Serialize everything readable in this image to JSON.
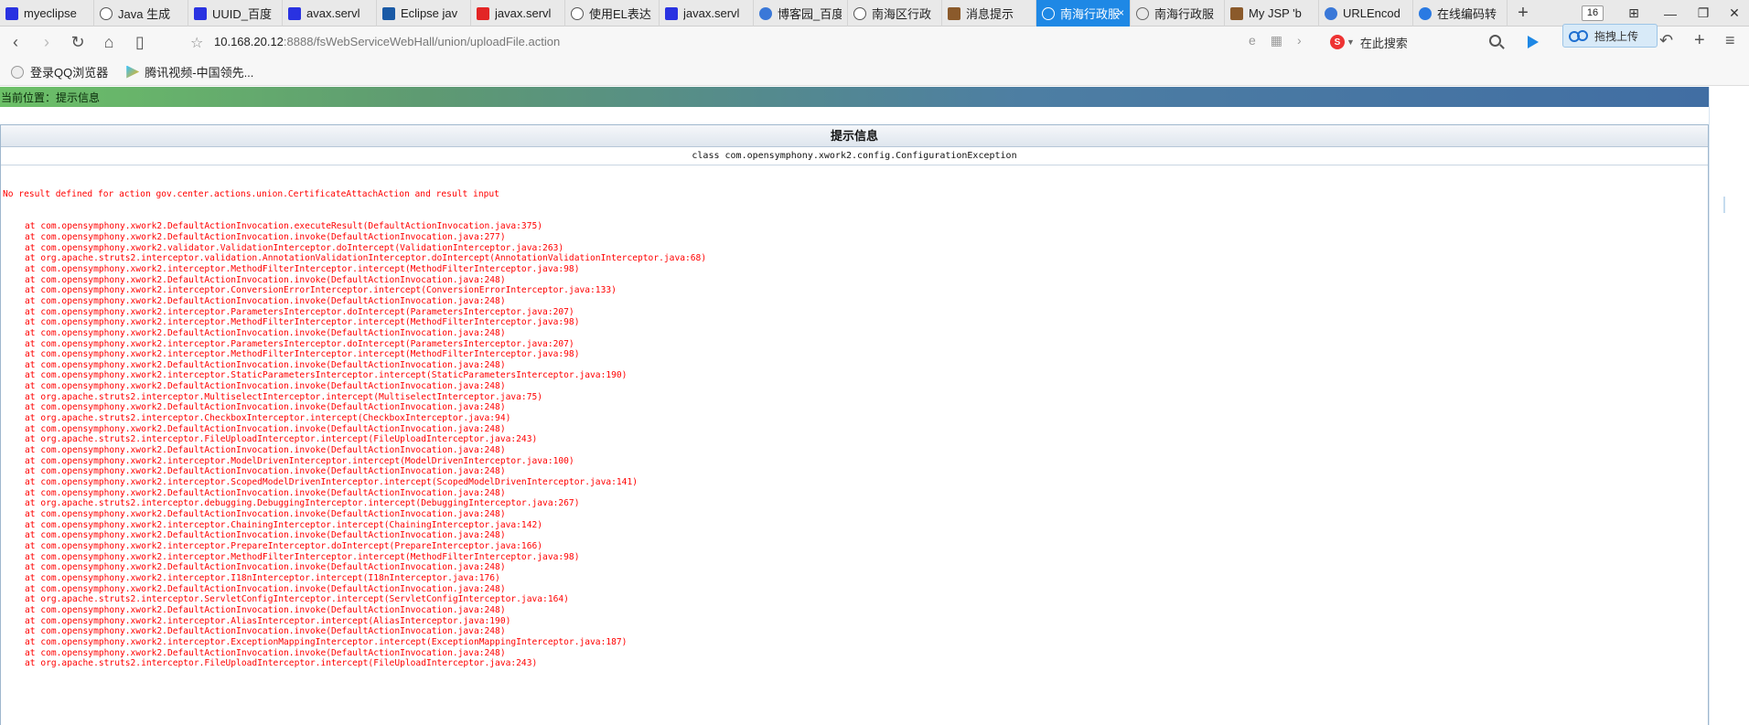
{
  "tabs": [
    {
      "label": "myeclipse",
      "icon": "baidu-paw-icon",
      "color": "#2932e1"
    },
    {
      "label": "Java 生成",
      "icon": "csdn-icon",
      "color": "#ffffff"
    },
    {
      "label": "UUID_百度",
      "icon": "baidu-paw-icon",
      "color": "#2932e1"
    },
    {
      "label": "avax.servl",
      "icon": "baidu-paw-icon",
      "color": "#2932e1"
    },
    {
      "label": "Eclipse jav",
      "icon": "c-logo-icon",
      "color": "#1a5aa6"
    },
    {
      "label": "javax.servl",
      "icon": "red-logo-icon",
      "color": "#e32525"
    },
    {
      "label": "使用EL表达",
      "icon": "csdn-icon",
      "color": "#ffffff"
    },
    {
      "label": "javax.servl",
      "icon": "baidu-paw-icon",
      "color": "#2932e1"
    },
    {
      "label": "博客园_百度",
      "icon": "paw-icon",
      "color": "#3a78d8"
    },
    {
      "label": "南海区行政",
      "icon": "csdn-icon",
      "color": "#ffffff"
    },
    {
      "label": "消息提示",
      "icon": "page-icon",
      "color": "#8b5a2b"
    },
    {
      "label": "南海行政服",
      "icon": "globe-icon",
      "color": "#ffffff",
      "active": true
    },
    {
      "label": "南海行政服",
      "icon": "globe-icon",
      "color": "#666666"
    },
    {
      "label": "My JSP 'b",
      "icon": "page-icon",
      "color": "#8b5a2b"
    },
    {
      "label": "URLEncod",
      "icon": "paw-icon",
      "color": "#3a78d8"
    },
    {
      "label": "在线编码转",
      "icon": "chrome-icon",
      "color": "#2a7ae2"
    }
  ],
  "tab_close": "×",
  "new_tab": "+",
  "tab_counter": "16",
  "window_controls": [
    "⊞",
    "—",
    "❐",
    "✕"
  ],
  "upload_tip": "拖拽上传",
  "address": {
    "host": "10.168.20.12",
    "path": ":8888/fsWebServiceWebHall/union/uploadFile.action",
    "search_placeholder": "在此搜索",
    "search_engine": "S"
  },
  "bookmarks": [
    {
      "label": "登录QQ浏览器",
      "icon": "user-icon"
    },
    {
      "label": "腾讯视频-中国领先...",
      "icon": "tencent-video-icon"
    }
  ],
  "location": "当前位置：提示信息",
  "panel": {
    "title": "提示信息",
    "exception_class": "class com.opensymphony.xwork2.config.ConfigurationException"
  },
  "trace": {
    "message": "No result defined for action gov.center.actions.union.CertificateAttachAction and result input",
    "frames": [
      "at com.opensymphony.xwork2.DefaultActionInvocation.executeResult(DefaultActionInvocation.java:375)",
      "at com.opensymphony.xwork2.DefaultActionInvocation.invoke(DefaultActionInvocation.java:277)",
      "at com.opensymphony.xwork2.validator.ValidationInterceptor.doIntercept(ValidationInterceptor.java:263)",
      "at org.apache.struts2.interceptor.validation.AnnotationValidationInterceptor.doIntercept(AnnotationValidationInterceptor.java:68)",
      "at com.opensymphony.xwork2.interceptor.MethodFilterInterceptor.intercept(MethodFilterInterceptor.java:98)",
      "at com.opensymphony.xwork2.DefaultActionInvocation.invoke(DefaultActionInvocation.java:248)",
      "at com.opensymphony.xwork2.interceptor.ConversionErrorInterceptor.intercept(ConversionErrorInterceptor.java:133)",
      "at com.opensymphony.xwork2.DefaultActionInvocation.invoke(DefaultActionInvocation.java:248)",
      "at com.opensymphony.xwork2.interceptor.ParametersInterceptor.doIntercept(ParametersInterceptor.java:207)",
      "at com.opensymphony.xwork2.interceptor.MethodFilterInterceptor.intercept(MethodFilterInterceptor.java:98)",
      "at com.opensymphony.xwork2.DefaultActionInvocation.invoke(DefaultActionInvocation.java:248)",
      "at com.opensymphony.xwork2.interceptor.ParametersInterceptor.doIntercept(ParametersInterceptor.java:207)",
      "at com.opensymphony.xwork2.interceptor.MethodFilterInterceptor.intercept(MethodFilterInterceptor.java:98)",
      "at com.opensymphony.xwork2.DefaultActionInvocation.invoke(DefaultActionInvocation.java:248)",
      "at com.opensymphony.xwork2.interceptor.StaticParametersInterceptor.intercept(StaticParametersInterceptor.java:190)",
      "at com.opensymphony.xwork2.DefaultActionInvocation.invoke(DefaultActionInvocation.java:248)",
      "at org.apache.struts2.interceptor.MultiselectInterceptor.intercept(MultiselectInterceptor.java:75)",
      "at com.opensymphony.xwork2.DefaultActionInvocation.invoke(DefaultActionInvocation.java:248)",
      "at org.apache.struts2.interceptor.CheckboxInterceptor.intercept(CheckboxInterceptor.java:94)",
      "at com.opensymphony.xwork2.DefaultActionInvocation.invoke(DefaultActionInvocation.java:248)",
      "at org.apache.struts2.interceptor.FileUploadInterceptor.intercept(FileUploadInterceptor.java:243)",
      "at com.opensymphony.xwork2.DefaultActionInvocation.invoke(DefaultActionInvocation.java:248)",
      "at com.opensymphony.xwork2.interceptor.ModelDrivenInterceptor.intercept(ModelDrivenInterceptor.java:100)",
      "at com.opensymphony.xwork2.DefaultActionInvocation.invoke(DefaultActionInvocation.java:248)",
      "at com.opensymphony.xwork2.interceptor.ScopedModelDrivenInterceptor.intercept(ScopedModelDrivenInterceptor.java:141)",
      "at com.opensymphony.xwork2.DefaultActionInvocation.invoke(DefaultActionInvocation.java:248)",
      "at org.apache.struts2.interceptor.debugging.DebuggingInterceptor.intercept(DebuggingInterceptor.java:267)",
      "at com.opensymphony.xwork2.DefaultActionInvocation.invoke(DefaultActionInvocation.java:248)",
      "at com.opensymphony.xwork2.interceptor.ChainingInterceptor.intercept(ChainingInterceptor.java:142)",
      "at com.opensymphony.xwork2.DefaultActionInvocation.invoke(DefaultActionInvocation.java:248)",
      "at com.opensymphony.xwork2.interceptor.PrepareInterceptor.doIntercept(PrepareInterceptor.java:166)",
      "at com.opensymphony.xwork2.interceptor.MethodFilterInterceptor.intercept(MethodFilterInterceptor.java:98)",
      "at com.opensymphony.xwork2.DefaultActionInvocation.invoke(DefaultActionInvocation.java:248)",
      "at com.opensymphony.xwork2.interceptor.I18nInterceptor.intercept(I18nInterceptor.java:176)",
      "at com.opensymphony.xwork2.DefaultActionInvocation.invoke(DefaultActionInvocation.java:248)",
      "at org.apache.struts2.interceptor.ServletConfigInterceptor.intercept(ServletConfigInterceptor.java:164)",
      "at com.opensymphony.xwork2.DefaultActionInvocation.invoke(DefaultActionInvocation.java:248)",
      "at com.opensymphony.xwork2.interceptor.AliasInterceptor.intercept(AliasInterceptor.java:190)",
      "at com.opensymphony.xwork2.DefaultActionInvocation.invoke(DefaultActionInvocation.java:248)",
      "at com.opensymphony.xwork2.interceptor.ExceptionMappingInterceptor.intercept(ExceptionMappingInterceptor.java:187)",
      "at com.opensymphony.xwork2.DefaultActionInvocation.invoke(DefaultActionInvocation.java:248)",
      "at org.apache.struts2.interceptor.FileUploadInterceptor.intercept(FileUploadInterceptor.java:243)"
    ]
  }
}
